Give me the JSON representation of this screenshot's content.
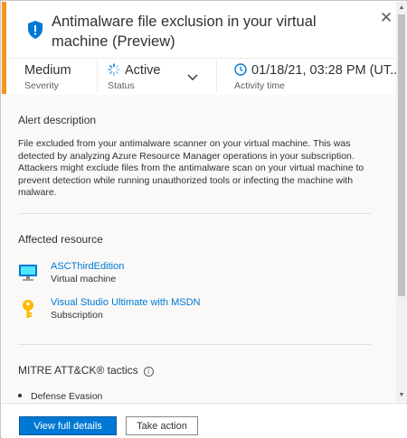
{
  "alert": {
    "title": "Antimalware file exclusion in your virtual machine (Preview)",
    "close_glyph": "✕",
    "severity": {
      "value": "Medium",
      "label": "Severity"
    },
    "status": {
      "value": "Active",
      "label": "Status"
    },
    "activity_time": {
      "value": "01/18/21, 03:28 PM (UT...",
      "label": "Activity time"
    }
  },
  "description": {
    "heading": "Alert description",
    "paragraph1": "File excluded from your antimalware scanner on your virtual machine. This was detected by analyzing Azure Resource Manager operations in your subscription.",
    "paragraph2": "Attackers might exclude files from the antimalware scan on your virtual machine to prevent detection while running unauthorized tools or infecting the machine with malware."
  },
  "affected": {
    "heading": "Affected resource",
    "resources": [
      {
        "name": "ASCThirdEdition",
        "type": "Virtual machine",
        "icon": "virtual-machine-icon"
      },
      {
        "name": "Visual Studio Ultimate with MSDN",
        "type": "Subscription",
        "icon": "key-icon"
      }
    ]
  },
  "mitre": {
    "heading": "MITRE ATT&CK® tactics",
    "info_glyph": "i",
    "tactics": [
      "Defense Evasion"
    ]
  },
  "footer": {
    "primary_label": "View full details",
    "secondary_label": "Take action"
  },
  "colors": {
    "accent": "#f7941d",
    "link": "#0078d4",
    "primary_button": "#0078d4",
    "status_spinner": "#0078d4"
  }
}
